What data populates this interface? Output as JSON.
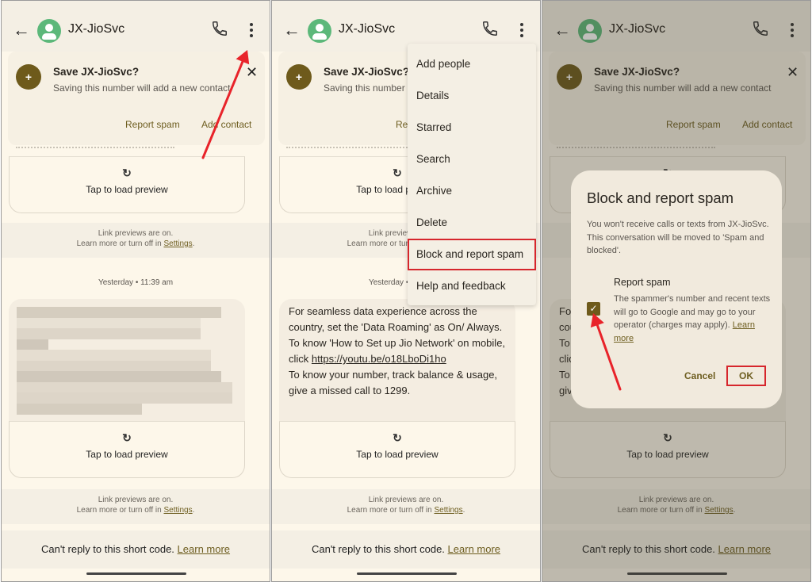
{
  "conversation": {
    "contact_name": "JX-JioSvc",
    "icons": {
      "back": "arrow-left-icon",
      "call": "phone-icon",
      "more": "more-vert-icon",
      "avatar": "person-icon"
    }
  },
  "save_banner": {
    "title": "Save JX-JioSvc?",
    "subtitle": "Saving this number will add a new contact",
    "report_spam": "Report spam",
    "add_contact": "Add contact",
    "close_icon": "close-icon",
    "avatar_icon": "person-add-icon"
  },
  "preview": {
    "reload_icon": "↻",
    "label": "Tap to load preview"
  },
  "link_info": {
    "line1": "Link previews are on.",
    "line2_prefix": "Learn more or turn off in ",
    "settings": "Settings",
    "suffix": "."
  },
  "timestamp": "Yesterday • 11:39 am",
  "message": {
    "line1": "For seamless data experience across the country, set the 'Data Roaming' as On/ Always.",
    "line2_prefix": "To know 'How to Set up Jio Network' on mobile, click ",
    "url": "https://youtu.be/o18LboDi1ho",
    "line3": "To know your number, track balance & usage, give a missed call to 1299."
  },
  "footer": {
    "text": "Can't reply to this short code. ",
    "learn_more": "Learn more"
  },
  "menu": {
    "items": [
      {
        "label": "Add people"
      },
      {
        "label": "Details"
      },
      {
        "label": "Starred"
      },
      {
        "label": "Search"
      },
      {
        "label": "Archive"
      },
      {
        "label": "Delete"
      },
      {
        "label": "Block and report spam",
        "highlighted": true
      },
      {
        "label": "Help and feedback"
      }
    ]
  },
  "dialog": {
    "title": "Block and report spam",
    "body": "You won't receive calls or texts from JX-JioSvc. This conversation will be moved to 'Spam and blocked'.",
    "checkbox_label": "Report spam",
    "checkbox_checked": true,
    "checkbox_desc": "The spammer's number and recent texts will go to Google and may go to your operator (charges may apply). ",
    "learn_more": "Learn more",
    "cancel": "Cancel",
    "ok": "OK"
  },
  "colors": {
    "accent": "#6e5e20",
    "avatar": "#5cb87a",
    "highlight_box": "#d6262c",
    "background": "#fdf7ea"
  }
}
